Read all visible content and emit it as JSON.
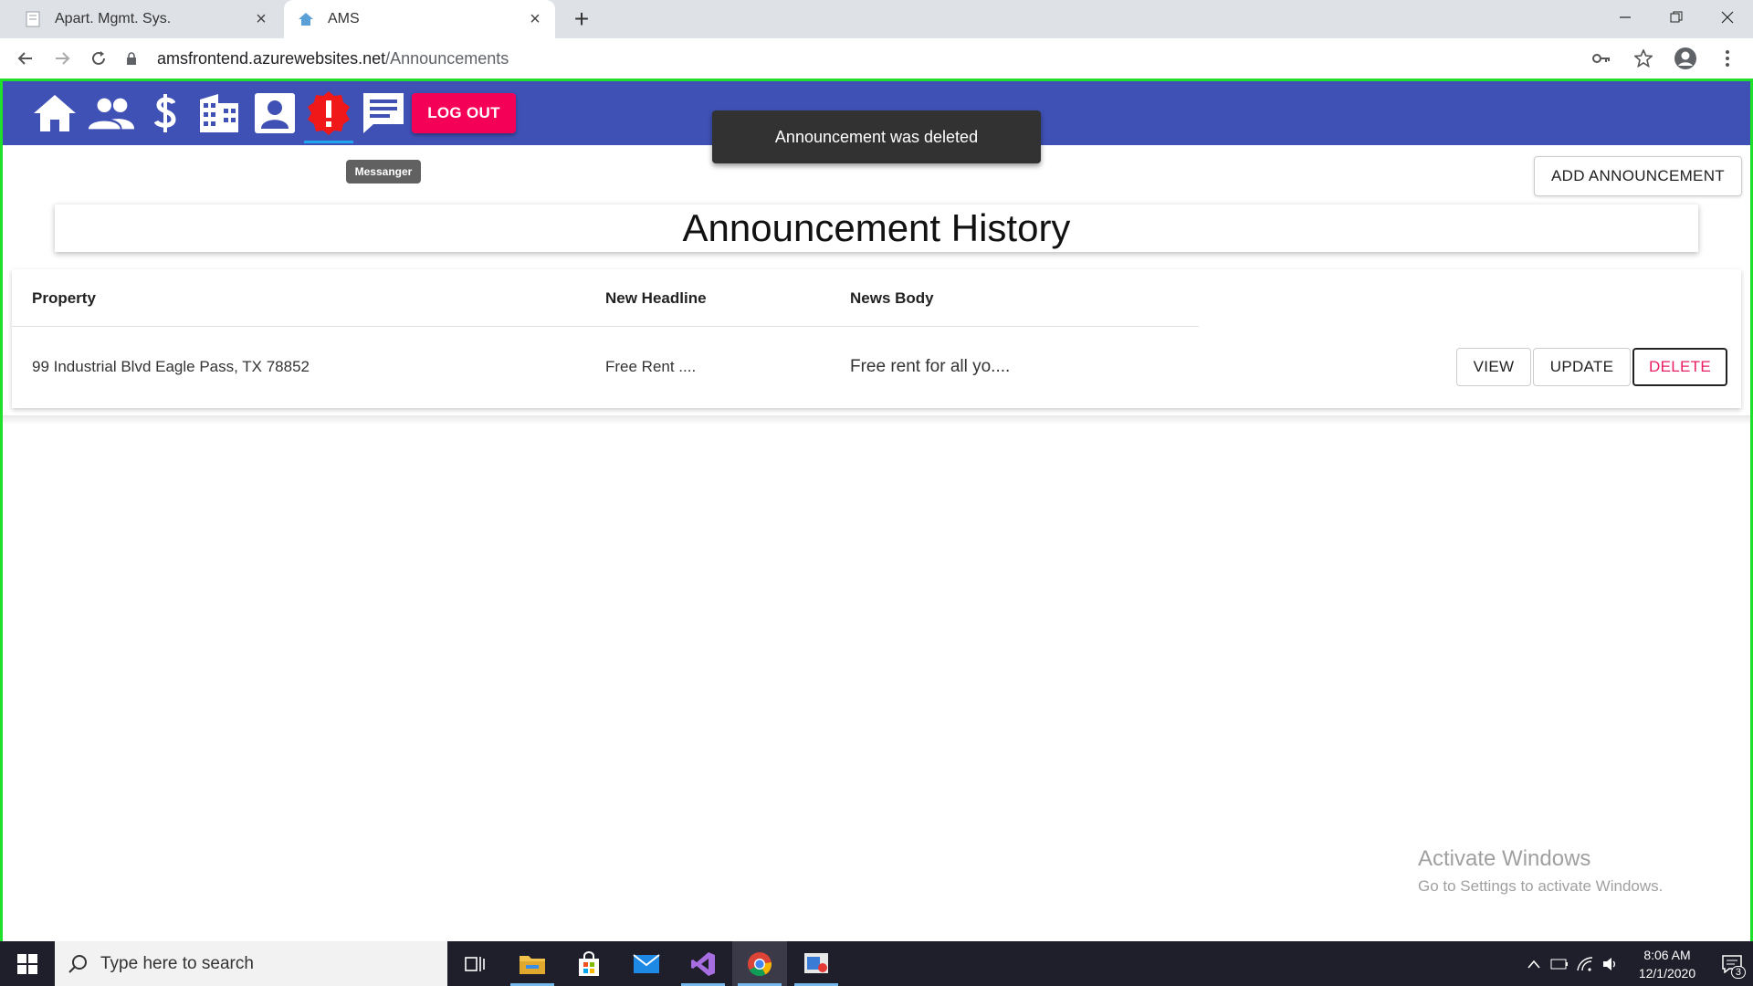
{
  "browser": {
    "tabs": [
      {
        "label": "Apart. Mgmt. Sys.",
        "active": false
      },
      {
        "label": "AMS",
        "active": true
      }
    ],
    "url_host": "amsfrontend.azurewebsites.net",
    "url_path": "/Announcements"
  },
  "app": {
    "nav_icons": [
      "home-icon",
      "people-icon",
      "dollar-icon",
      "building-icon",
      "contact-icon",
      "alert-icon",
      "messenger-icon"
    ],
    "logout_label": "LOG OUT",
    "tooltip": "Messanger",
    "snackbar": "Announcement was deleted",
    "add_button": "ADD ANNOUNCEMENT",
    "page_title": "Announcement History",
    "colors": {
      "appbar": "#3f51b5",
      "logout": "#f50057",
      "delete_text": "#e91e63"
    }
  },
  "table": {
    "headers": [
      "Property",
      "New Headline",
      "News Body"
    ],
    "rows": [
      {
        "property": "99 Industrial Blvd Eagle Pass, TX 78852",
        "headline": "Free Rent ....",
        "body": "Free rent for all yo....",
        "actions": [
          "VIEW",
          "UPDATE",
          "DELETE"
        ]
      }
    ]
  },
  "watermark": {
    "line1": "Activate Windows",
    "line2": "Go to Settings to activate Windows."
  },
  "taskbar": {
    "search_placeholder": "Type here to search",
    "time": "8:06 AM",
    "date": "12/1/2020",
    "notification_count": "3"
  }
}
